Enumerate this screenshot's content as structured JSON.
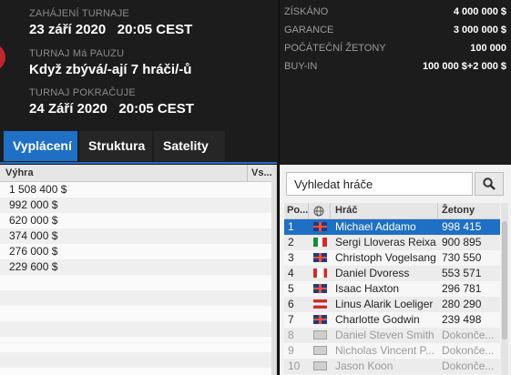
{
  "tournament": {
    "start_label": "ZAHÁJENÍ TURNAJE",
    "start_value": "23 září 2020   20:05 CEST",
    "paused_label": "TURNAJ Má PAUZU",
    "paused_value": "Když zbývá/-ají 7 hráči/-ů",
    "resume_label": "TURNAJ POKRAČUJE",
    "resume_value": "24 Září 2020   20:05 CEST"
  },
  "stats": [
    {
      "label": "ZÍSKÁNO",
      "value": "4 000 000 $"
    },
    {
      "label": "GARANCE",
      "value": "3 000 000 $"
    },
    {
      "label": "POČÁTEČNÍ ŽETONY",
      "value": "100 000"
    },
    {
      "label": "BUY-IN",
      "value": "100 000 $+2 000 $"
    }
  ],
  "tabs": [
    "Vyplácení",
    "Struktura",
    "Satelity"
  ],
  "payout": {
    "headers": [
      "Výhra",
      "Vs..."
    ],
    "rows": [
      "1 508 400 $",
      "992 000 $",
      "620 000 $",
      "374 000 $",
      "276 000 $",
      "229 600 $"
    ]
  },
  "search": {
    "placeholder": "Vyhledat hráče"
  },
  "players": {
    "headers": [
      "Po...",
      "Hráč",
      "Žetony"
    ],
    "rows": [
      {
        "pos": "1",
        "flag": "gb",
        "name": "Michael Addamo",
        "chips": "998 415"
      },
      {
        "pos": "2",
        "flag": "mx",
        "name": "Sergi Lloveras Reixa...",
        "chips": "900 895"
      },
      {
        "pos": "3",
        "flag": "gb",
        "name": "Christoph Vogelsang",
        "chips": "730 550"
      },
      {
        "pos": "4",
        "flag": "ca",
        "name": "Daniel Dvoress",
        "chips": "553 571"
      },
      {
        "pos": "5",
        "flag": "gb",
        "name": "Isaac Haxton",
        "chips": "296 781"
      },
      {
        "pos": "6",
        "flag": "at",
        "name": "Linus Alarik Loeliger",
        "chips": "280 290"
      },
      {
        "pos": "7",
        "flag": "gb",
        "name": "Charlotte Godwin",
        "chips": "239 498"
      },
      {
        "pos": "8",
        "flag": "grey",
        "name": "Daniel Steven Smith",
        "chips": "Dokonče..."
      },
      {
        "pos": "9",
        "flag": "grey",
        "name": "Nicholas Vincent P...",
        "chips": "Dokonče..."
      },
      {
        "pos": "10",
        "flag": "grey",
        "name": "Jason Koon",
        "chips": "Dokonče..."
      }
    ]
  }
}
